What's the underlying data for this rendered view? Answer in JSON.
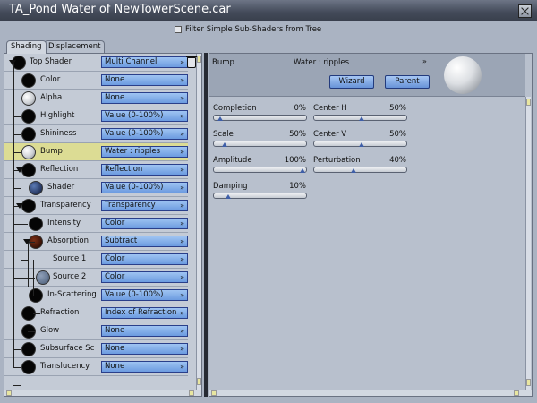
{
  "window": {
    "title": "TA_Pond Water of NewTowerScene.car"
  },
  "filter": {
    "label": "Filter Simple Sub-Shaders from Tree",
    "checked": false
  },
  "tabs": [
    {
      "label": "Shading",
      "active": true
    },
    {
      "label": "Displacement",
      "active": false
    }
  ],
  "tree": {
    "rows": [
      {
        "label": "Top Shader",
        "value": "Multi Channel",
        "ball": "black",
        "selected": false
      },
      {
        "label": "Color",
        "value": "None",
        "ball": "black",
        "selected": false
      },
      {
        "label": "Alpha",
        "value": "None",
        "ball": "white",
        "selected": false
      },
      {
        "label": "Highlight",
        "value": "Value (0-100%)",
        "ball": "black",
        "selected": false
      },
      {
        "label": "Shininess",
        "value": "Value (0-100%)",
        "ball": "black",
        "selected": false
      },
      {
        "label": "Bump",
        "value": "Water : ripples",
        "ball": "white",
        "selected": true
      },
      {
        "label": "Reflection",
        "value": "Reflection",
        "ball": "black",
        "selected": false
      },
      {
        "label": "Shader",
        "value": "Value (0-100%)",
        "ball": "blue",
        "selected": false
      },
      {
        "label": "Transparency",
        "value": "Transparency",
        "ball": "black",
        "selected": false
      },
      {
        "label": "Intensity",
        "value": "Color",
        "ball": "black",
        "selected": false
      },
      {
        "label": "Absorption",
        "value": "Subtract",
        "ball": "red",
        "selected": false
      },
      {
        "label": "Source 1",
        "value": "Color",
        "ball": "none",
        "selected": false
      },
      {
        "label": "Source 2",
        "value": "Color",
        "ball": "gray",
        "selected": false
      },
      {
        "label": "In-Scattering",
        "value": "Value (0-100%)",
        "ball": "black",
        "selected": false
      },
      {
        "label": "Refraction",
        "value": "Index of Refraction",
        "ball": "black",
        "selected": false
      },
      {
        "label": "Glow",
        "value": "None",
        "ball": "black",
        "selected": false
      },
      {
        "label": "Subsurface Sc",
        "value": "None",
        "ball": "black",
        "selected": false
      },
      {
        "label": "Translucency",
        "value": "None",
        "ball": "black",
        "selected": false
      }
    ]
  },
  "panel": {
    "channel_label": "Bump",
    "shader_name": "Water : ripples",
    "wizard_label": "Wizard",
    "parent_label": "Parent",
    "params": [
      {
        "name": "Completion",
        "value": "0%",
        "fraction": 0.0
      },
      {
        "name": "Center H",
        "value": "50%",
        "fraction": 0.5
      },
      {
        "name": "Scale",
        "value": "50%",
        "fraction": 0.05
      },
      {
        "name": "Center V",
        "value": "50%",
        "fraction": 0.5
      },
      {
        "name": "Amplitude",
        "value": "100%",
        "fraction": 1.0
      },
      {
        "name": "Perturbation",
        "value": "40%",
        "fraction": 0.4
      },
      {
        "name": "Damping",
        "value": "10%",
        "fraction": 0.1
      }
    ]
  },
  "colors": {
    "accent": "#6c9be0",
    "selection": "#dcdc94",
    "title_bar": "#4a5160"
  }
}
